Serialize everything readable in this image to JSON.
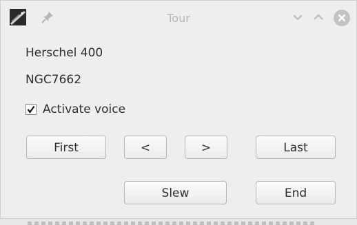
{
  "window": {
    "title": "Tour",
    "icons": {
      "app": "telescope-app-icon",
      "pin": "pin-icon",
      "minimize": "chevron-down-icon",
      "maximize": "chevron-up-icon",
      "close": "close-icon"
    },
    "colors": {
      "background": "#eeeeec",
      "title_text": "#b8b8b8",
      "close_button": "#c3c3c3"
    }
  },
  "content": {
    "catalog": "Herschel 400",
    "object": "NGC7662",
    "activate_voice": {
      "label": "Activate voice",
      "checked": true
    }
  },
  "buttons": {
    "first": "First",
    "prev": "<",
    "next": ">",
    "last": "Last",
    "slew": "Slew",
    "end": "End"
  }
}
